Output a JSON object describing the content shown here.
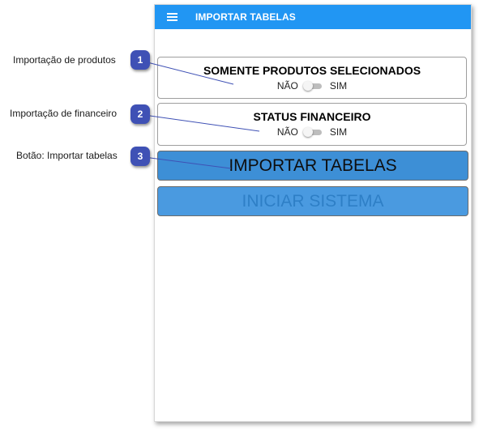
{
  "appbar": {
    "title": "IMPORTAR TABELAS",
    "menu_icon": "hamburger-menu-icon",
    "color": "#2196f3"
  },
  "cards": [
    {
      "title": "SOMENTE PRODUTOS SELECIONADOS",
      "off_label": "NÃO",
      "on_label": "SIM",
      "toggle_on": false
    },
    {
      "title": "STATUS FINANCEIRO",
      "off_label": "NÃO",
      "on_label": "SIM",
      "toggle_on": false
    }
  ],
  "buttons": {
    "import_label": "IMPORTAR TABELAS",
    "start_label": "INICIAR SISTEMA",
    "start_disabled": true
  },
  "annotations": [
    {
      "number": "1",
      "label": "Importação de produtos"
    },
    {
      "number": "2",
      "label": "Importação de financeiro"
    },
    {
      "number": "3",
      "label": "Botão: Importar tabelas"
    }
  ],
  "colors": {
    "badge": "#3f51b5",
    "button": "#3d8fd6",
    "leader_line": "#3f51b5"
  }
}
